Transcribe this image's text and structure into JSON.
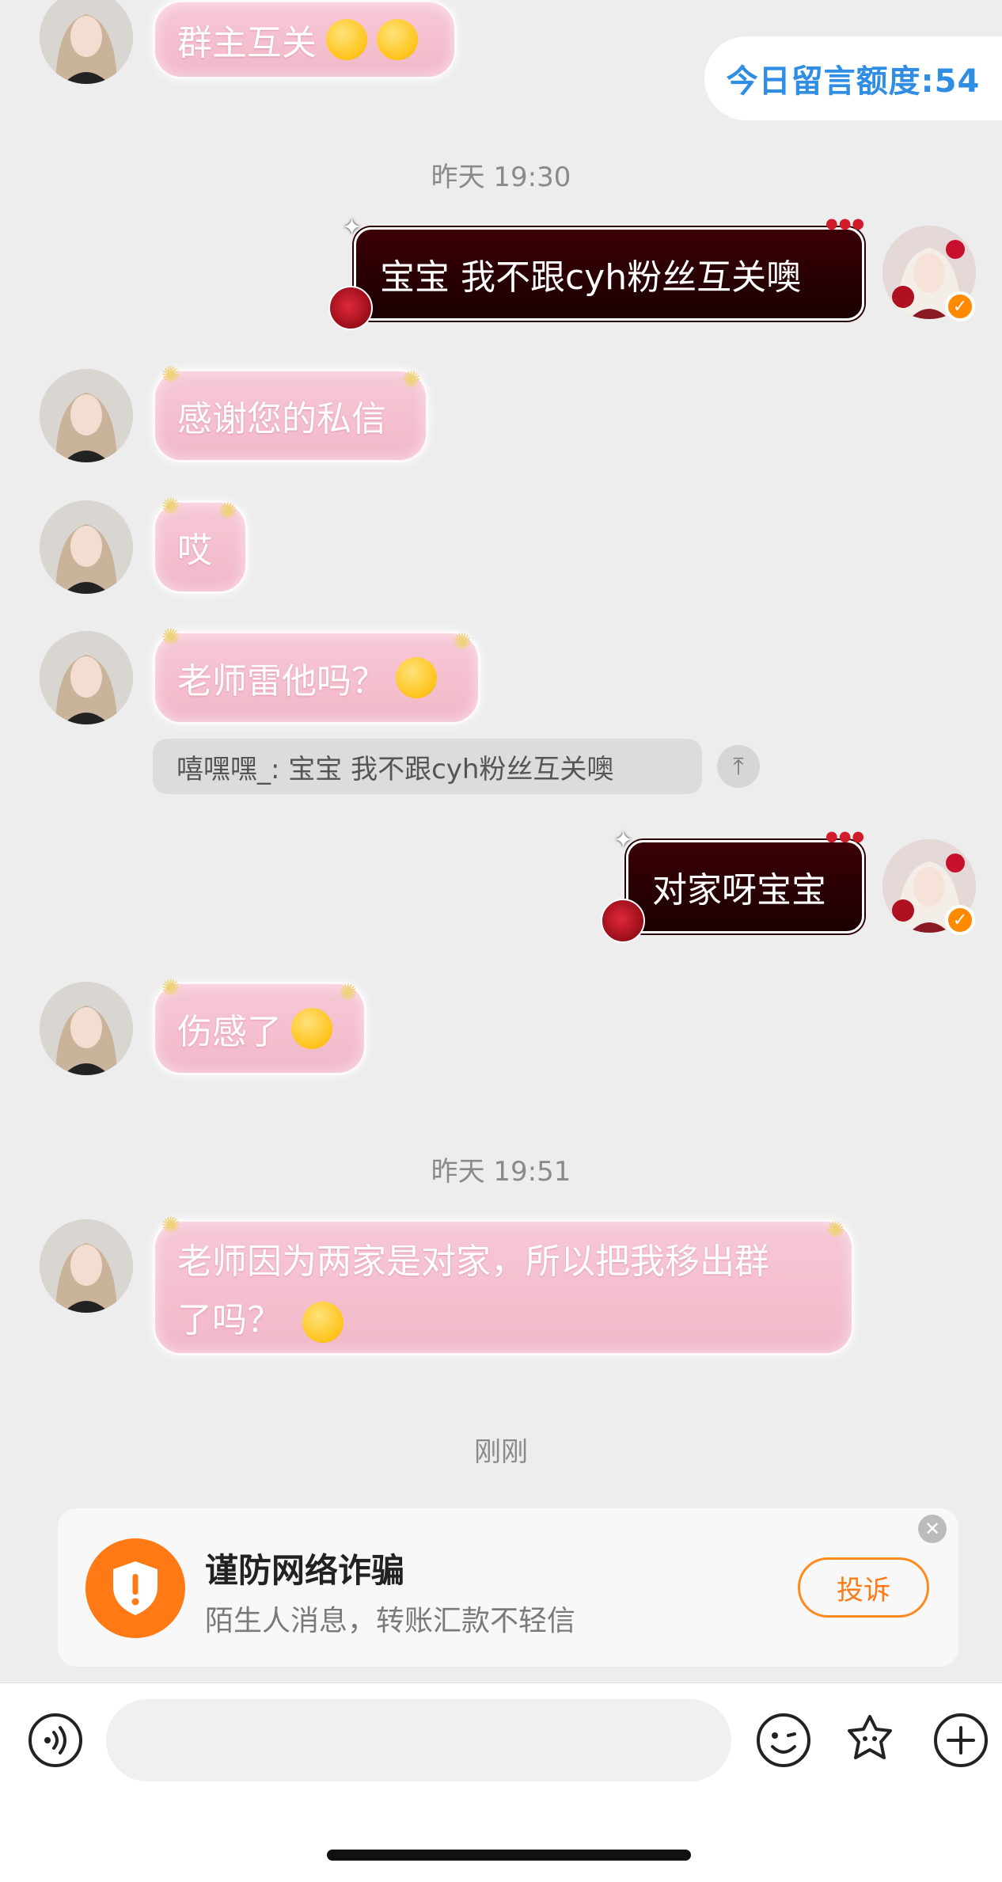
{
  "quota": {
    "label": "今日留言额度:54"
  },
  "timestamps": {
    "t1": "昨天 19:30",
    "t2": "昨天 19:51",
    "t3": "刚刚"
  },
  "messages": {
    "m0": "群主互关",
    "m1": "宝宝 我不跟cyh粉丝互关噢",
    "m2": "感谢您的私信",
    "m3": "哎",
    "m4": "老师雷他吗？",
    "m5_quote": "嘻嘿嘿_: 宝宝 我不跟cyh粉丝互关噢",
    "m6": "对家呀宝宝",
    "m7": "伤感了",
    "m8_line1": "老师因为两家是对家，所以把我移出群",
    "m8_line2": "了吗？"
  },
  "warning": {
    "title": "谨防网络诈骗",
    "subtitle": "陌生人消息，转账汇款不轻信",
    "report_label": "投诉"
  },
  "input": {
    "placeholder": ""
  },
  "icons": {
    "voice": "voice-icon",
    "emoji": "emoji-icon",
    "sticker": "sticker-icon",
    "plus": "plus-icon",
    "shield": "shield-icon",
    "close": "close-icon",
    "quote_up": "arrow-up-icon"
  },
  "colors": {
    "accent_blue": "#2f8de4",
    "warning_orange": "#ff7a14",
    "bubble_pink": "#f2b8c8",
    "bubble_dark": "#2a0004"
  }
}
